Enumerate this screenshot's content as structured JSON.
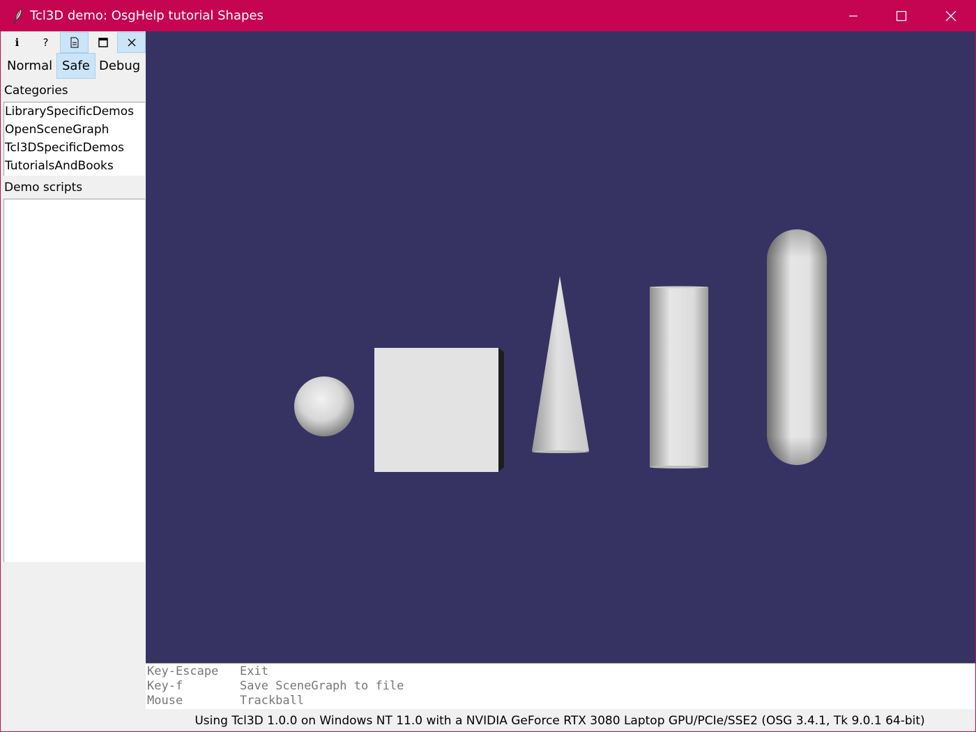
{
  "window": {
    "title": "Tcl3D demo: OsgHelp tutorial Shapes",
    "accent_color": "#c50552",
    "controls": [
      "minimize-icon",
      "maximize-icon",
      "close-icon"
    ]
  },
  "toolbar": {
    "info_label": "i",
    "help_label": "?",
    "buttons": [
      "info-icon",
      "help-icon",
      "document-icon",
      "window-icon",
      "close-icon"
    ]
  },
  "modes": {
    "normal": "Normal",
    "safe": "Safe",
    "debug": "Debug",
    "selected": "Safe"
  },
  "sidebar": {
    "categories_label": "Categories",
    "categories": [
      "LibrarySpecificDemos",
      "OpenSceneGraph",
      "Tcl3DSpecificDemos",
      "TutorialsAndBooks"
    ],
    "demo_scripts_label": "Demo scripts",
    "demo_scripts": []
  },
  "viewport": {
    "background_color": "#363363",
    "shapes": [
      "sphere",
      "box",
      "cone",
      "cylinder",
      "capsule"
    ]
  },
  "help": {
    "rows": [
      {
        "key": "Key-Escape",
        "action": "Exit"
      },
      {
        "key": "Key-f",
        "action": "Save SceneGraph to file"
      },
      {
        "key": "Mouse",
        "action": "Trackball"
      }
    ]
  },
  "status": {
    "text": "Using Tcl3D 1.0.0 on Windows NT 11.0 with a NVIDIA GeForce RTX 3080 Laptop GPU/PCIe/SSE2 (OSG 3.4.1, Tk 9.0.1 64-bit)"
  }
}
